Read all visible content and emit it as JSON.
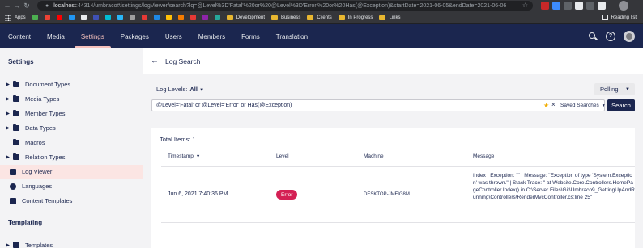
{
  "browser": {
    "url_host": "localhost",
    "url_rest": ":44314/umbraco#/settings/logViewer/search?lq=@Level%3D'Fatal'%20or%20@Level%3D'Error'%20or%20Has(@Exception)&startDate=2021-06-05&endDate=2021-06-06",
    "bookmarks": [
      {
        "label": "Apps",
        "type": "apps"
      },
      {
        "label": "Development",
        "type": "folder"
      },
      {
        "label": "Business",
        "type": "folder"
      },
      {
        "label": "Clients",
        "type": "folder"
      },
      {
        "label": "In Progress",
        "type": "folder"
      },
      {
        "label": "Links",
        "type": "folder"
      }
    ],
    "reading_list": "Reading list"
  },
  "sections": [
    "Content",
    "Media",
    "Settings",
    "Packages",
    "Users",
    "Members",
    "Forms",
    "Translation"
  ],
  "active_section": "Settings",
  "sidebar": {
    "title": "Settings",
    "items": [
      {
        "label": "Document Types",
        "icon": "folder-icon",
        "caret": true
      },
      {
        "label": "Media Types",
        "icon": "folder-icon",
        "caret": true
      },
      {
        "label": "Member Types",
        "icon": "folder-icon",
        "caret": true
      },
      {
        "label": "Data Types",
        "icon": "folder-icon",
        "caret": true
      },
      {
        "label": "Macros",
        "icon": "folder-icon",
        "caret": false
      },
      {
        "label": "Relation Types",
        "icon": "folder-icon",
        "caret": true
      },
      {
        "label": "Log Viewer",
        "icon": "log-viewer-icon",
        "caret": false,
        "active": true
      },
      {
        "label": "Languages",
        "icon": "globe-icon",
        "caret": false
      },
      {
        "label": "Content Templates",
        "icon": "content-template-icon",
        "caret": false
      }
    ],
    "section2_title": "Templating",
    "section2_items": [
      {
        "label": "Templates",
        "icon": "folder-icon"
      }
    ]
  },
  "main": {
    "title": "Log Search",
    "log_levels_label": "Log Levels:",
    "log_levels_value": "All",
    "polling_label": "Polling",
    "query": "@Level='Fatal' or @Level='Error' or Has(@Exception)",
    "saved_searches_label": "Saved Searches",
    "search_button": "Search",
    "total_items": "Total Items: 1",
    "columns": [
      "Timestamp",
      "Level",
      "Machine",
      "Message"
    ],
    "rows": [
      {
        "timestamp": "Jun 6, 2021 7:40:36 PM",
        "level": "Error",
        "machine": "DESKTOP-JMFIG8M",
        "message": "Index | Exception: \"\" | Message: \"Exception of type 'System.Exception' was thrown.\" | Stack Trace: \" at Website.Core.Controllers.HomePageController.Index() in C:\\Server Files\\Git\\Umbraco9_GettingUpAndRunning\\Controllers\\RenderMvcController.cs:line 25\""
      }
    ]
  },
  "colors": {
    "header_bg": "#1b264f",
    "active_section": "#f5c1bc",
    "error_badge": "#d42054",
    "selected_item_bg": "#fbe5e3"
  }
}
